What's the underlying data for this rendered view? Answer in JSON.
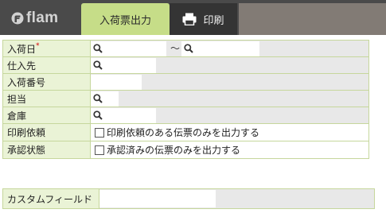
{
  "app": {
    "logo_text": "flam"
  },
  "tabs": {
    "active_label": "入荷票出力",
    "print_label": "印刷"
  },
  "form": {
    "rows": [
      {
        "label": "入荷日",
        "required_mark": "*",
        "range_separator": "〜"
      },
      {
        "label": "仕入先"
      },
      {
        "label": "入荷番号"
      },
      {
        "label": "担当"
      },
      {
        "label": "倉庫"
      },
      {
        "label": "印刷依頼",
        "checkbox_label": "印刷依頼のある伝票のみを出力する",
        "checked": false
      },
      {
        "label": "承認状態",
        "checkbox_label": "承認済みの伝票のみを出力する",
        "checked": false
      }
    ]
  },
  "custom_field": {
    "label": "カスタムフィールド"
  },
  "colors": {
    "topbar": "#4a4a4a",
    "tab_active": "#c6dd88",
    "label_bg": "#eaf3d6",
    "border": "#c6d79c",
    "required": "#d40000"
  }
}
